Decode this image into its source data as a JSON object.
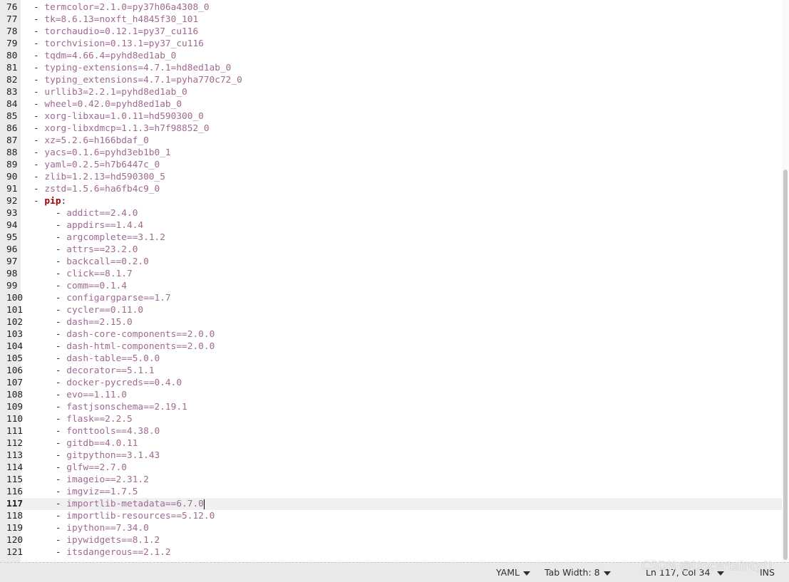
{
  "editor": {
    "current_line": 117,
    "lines": [
      {
        "n": "76",
        "indent": "",
        "text": "termcolor=2.1.0=py37h06a4308_0"
      },
      {
        "n": "77",
        "indent": "",
        "text": "tk=8.6.13=noxft_h4845f30_101"
      },
      {
        "n": "78",
        "indent": "",
        "text": "torchaudio=0.12.1=py37_cu116"
      },
      {
        "n": "79",
        "indent": "",
        "text": "torchvision=0.13.1=py37_cu116"
      },
      {
        "n": "80",
        "indent": "",
        "text": "tqdm=4.66.4=pyhd8ed1ab_0"
      },
      {
        "n": "81",
        "indent": "",
        "text": "typing-extensions=4.7.1=hd8ed1ab_0"
      },
      {
        "n": "82",
        "indent": "",
        "text": "typing_extensions=4.7.1=pyha770c72_0"
      },
      {
        "n": "83",
        "indent": "",
        "text": "urllib3=2.2.1=pyhd8ed1ab_0"
      },
      {
        "n": "84",
        "indent": "",
        "text": "wheel=0.42.0=pyhd8ed1ab_0"
      },
      {
        "n": "85",
        "indent": "",
        "text": "xorg-libxau=1.0.11=hd590300_0"
      },
      {
        "n": "86",
        "indent": "",
        "text": "xorg-libxdmcp=1.1.3=h7f98852_0"
      },
      {
        "n": "87",
        "indent": "",
        "text": "xz=5.2.6=h166bdaf_0"
      },
      {
        "n": "88",
        "indent": "",
        "text": "yacs=0.1.6=pyhd3eb1b0_1"
      },
      {
        "n": "89",
        "indent": "",
        "text": "yaml=0.2.5=h7b6447c_0"
      },
      {
        "n": "90",
        "indent": "",
        "text": "zlib=1.2.13=hd590300_5"
      },
      {
        "n": "91",
        "indent": "",
        "text": "zstd=1.5.6=ha6fb4c9_0"
      },
      {
        "n": "92",
        "indent": "",
        "key": "pip",
        "text": ""
      },
      {
        "n": "93",
        "indent": "    ",
        "text": "addict==2.4.0"
      },
      {
        "n": "94",
        "indent": "    ",
        "text": "appdirs==1.4.4"
      },
      {
        "n": "95",
        "indent": "    ",
        "text": "argcomplete==3.1.2"
      },
      {
        "n": "96",
        "indent": "    ",
        "text": "attrs==23.2.0"
      },
      {
        "n": "97",
        "indent": "    ",
        "text": "backcall==0.2.0"
      },
      {
        "n": "98",
        "indent": "    ",
        "text": "click==8.1.7"
      },
      {
        "n": "99",
        "indent": "    ",
        "text": "comm==0.1.4"
      },
      {
        "n": "100",
        "indent": "    ",
        "text": "configargparse==1.7"
      },
      {
        "n": "101",
        "indent": "    ",
        "text": "cycler==0.11.0"
      },
      {
        "n": "102",
        "indent": "    ",
        "text": "dash==2.15.0"
      },
      {
        "n": "103",
        "indent": "    ",
        "text": "dash-core-components==2.0.0"
      },
      {
        "n": "104",
        "indent": "    ",
        "text": "dash-html-components==2.0.0"
      },
      {
        "n": "105",
        "indent": "    ",
        "text": "dash-table==5.0.0"
      },
      {
        "n": "106",
        "indent": "    ",
        "text": "decorator==5.1.1"
      },
      {
        "n": "107",
        "indent": "    ",
        "text": "docker-pycreds==0.4.0"
      },
      {
        "n": "108",
        "indent": "    ",
        "text": "evo==1.11.0"
      },
      {
        "n": "109",
        "indent": "    ",
        "text": "fastjsonschema==2.19.1"
      },
      {
        "n": "110",
        "indent": "    ",
        "text": "flask==2.2.5"
      },
      {
        "n": "111",
        "indent": "    ",
        "text": "fonttools==4.38.0"
      },
      {
        "n": "112",
        "indent": "    ",
        "text": "gitdb==4.0.11"
      },
      {
        "n": "113",
        "indent": "    ",
        "text": "gitpython==3.1.43"
      },
      {
        "n": "114",
        "indent": "    ",
        "text": "glfw==2.7.0"
      },
      {
        "n": "115",
        "indent": "    ",
        "text": "imageio==2.31.2"
      },
      {
        "n": "116",
        "indent": "    ",
        "text": "imgviz==1.7.5"
      },
      {
        "n": "117",
        "indent": "    ",
        "text": "importlib-metadata==6.7.0"
      },
      {
        "n": "118",
        "indent": "    ",
        "text": "importlib-resources==5.12.0"
      },
      {
        "n": "119",
        "indent": "    ",
        "text": "ipython==7.34.0"
      },
      {
        "n": "120",
        "indent": "    ",
        "text": "ipywidgets==8.1.2"
      },
      {
        "n": "121",
        "indent": "    ",
        "text": "itsdangerous==2.1.2"
      }
    ]
  },
  "statusbar": {
    "language": "YAML",
    "tab_width": "Tab Width: 8",
    "position": "Ln 117, Col 34",
    "mode": "INS"
  },
  "watermark": "CSDN @Uncertainty!!"
}
